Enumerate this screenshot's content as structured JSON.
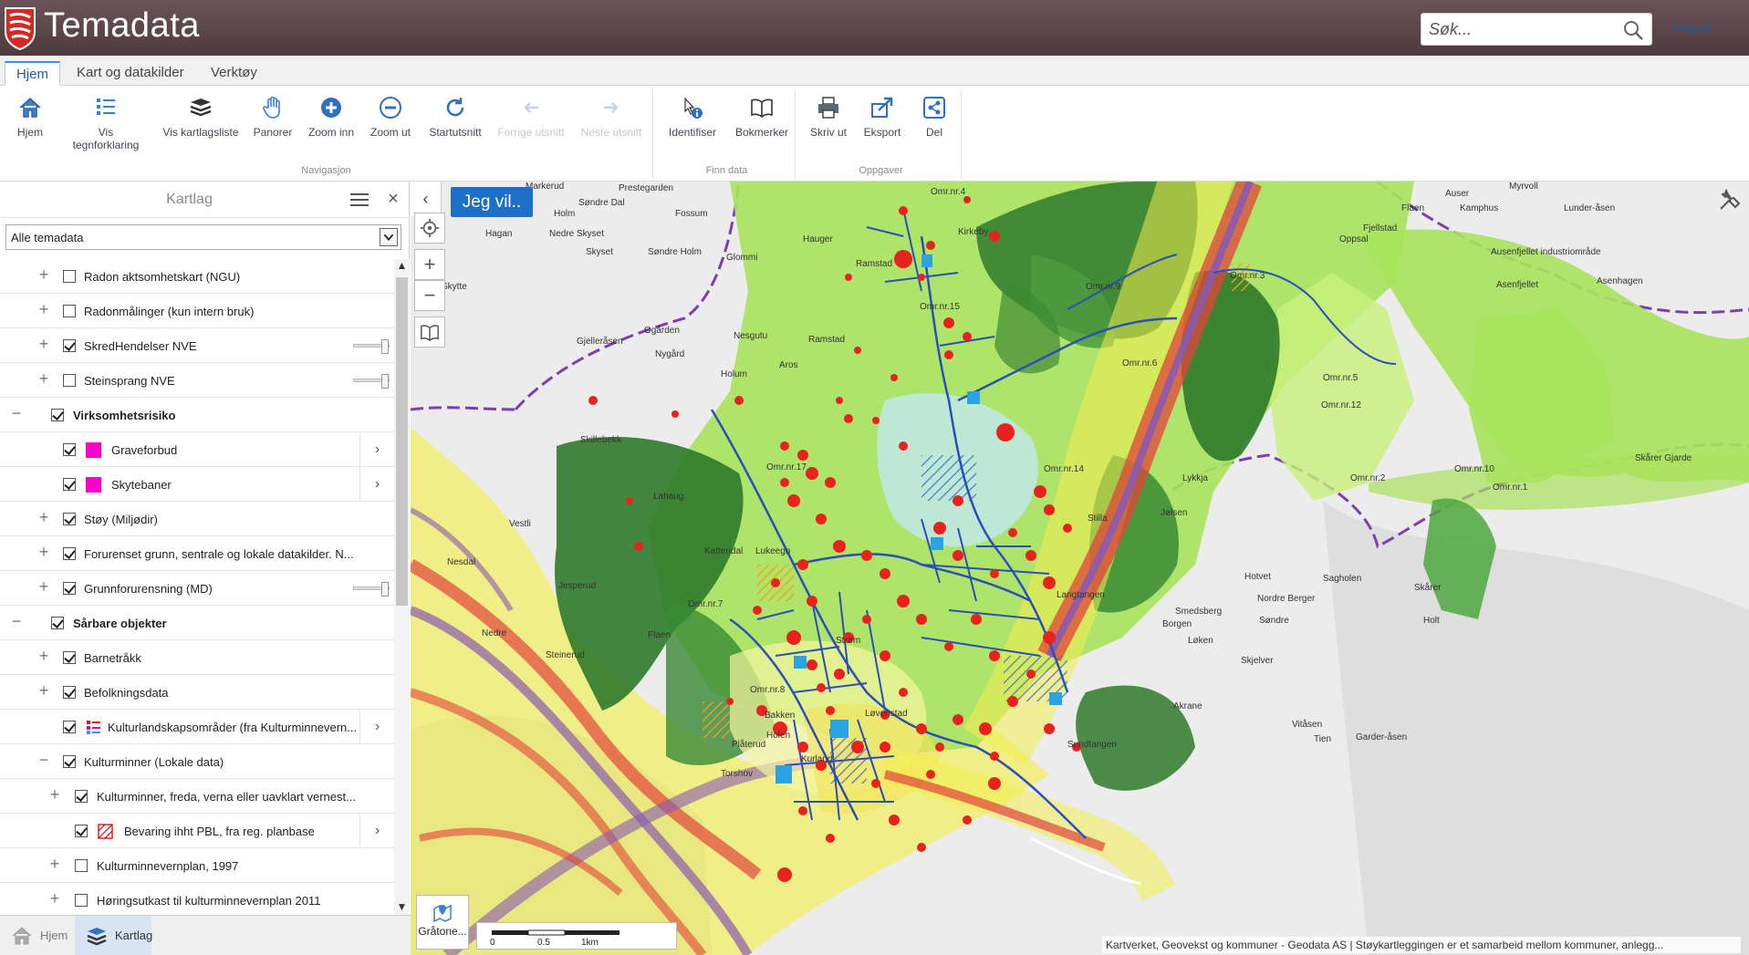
{
  "header": {
    "app_title": "Temadata",
    "search_placeholder": "Søk...",
    "logout": "Logg ut"
  },
  "tabs": [
    {
      "label": "Hjem",
      "active": true
    },
    {
      "label": "Kart og datakilder",
      "active": false
    },
    {
      "label": "Verktøy",
      "active": false
    }
  ],
  "ribbon": {
    "groups": {
      "navigasjon": "Navigasjon",
      "finn_data": "Finn data",
      "oppgaver": "Oppgaver"
    },
    "buttons": {
      "hjem": "Hjem",
      "vis_tegnforklaring": "Vis tegnforklaring",
      "vis_kartlagsliste": "Vis kartlagsliste",
      "panorer": "Panorer",
      "zoom_inn": "Zoom inn",
      "zoom_ut": "Zoom ut",
      "startutsnitt": "Startutsnitt",
      "forrige_utsnitt": "Forrige utsnitt",
      "neste_utsnitt": "Neste utsnitt",
      "identifiser": "Identifiser",
      "bokmerker": "Bokmerker",
      "skriv_ut": "Skriv ut",
      "eksport": "Eksport",
      "del": "Del"
    }
  },
  "panel": {
    "title": "Kartlag",
    "theme_select": "Alle temadata",
    "layers": [
      {
        "label": "Radon aktsomhetskart (NGU)",
        "checked": false,
        "expander": "+"
      },
      {
        "label": "Radonmålinger (kun intern bruk)",
        "checked": false,
        "expander": "+"
      },
      {
        "label": "SkredHendelser NVE",
        "checked": true,
        "expander": "+",
        "slider": true
      },
      {
        "label": "Steinsprang NVE",
        "checked": false,
        "expander": "+",
        "slider": true
      },
      {
        "label": "Virksomhetsrisiko",
        "checked": true,
        "expander": "−",
        "bold": true
      },
      {
        "label": "Graveforbud",
        "checked": true,
        "swatch": "#ff00cc",
        "chevron": true
      },
      {
        "label": "Skytebaner",
        "checked": true,
        "swatch": "#ff00cc",
        "chevron": true
      },
      {
        "label": "Støy (Miljødir)",
        "checked": true,
        "expander": "+"
      },
      {
        "label": "Forurenset grunn, sentrale og lokale datakilder. N...",
        "checked": true,
        "expander": "+"
      },
      {
        "label": "Grunnforurensning (MD)",
        "checked": true,
        "expander": "+",
        "slider": true
      },
      {
        "label": "Sårbare objekter",
        "checked": true,
        "expander": "−",
        "bold": true
      },
      {
        "label": "Barnetråkk",
        "checked": true,
        "expander": "+"
      },
      {
        "label": "Befolkningsdata",
        "checked": true,
        "expander": "+"
      },
      {
        "label": "Kulturlandskapsområder (fra Kulturminnevern...",
        "checked": true,
        "chevron": true
      },
      {
        "label": "Kulturminner (Lokale data)",
        "checked": true,
        "expander": "−"
      },
      {
        "label": "Kulturminner, freda, verna eller uavklart vernest...",
        "checked": true,
        "expander": "+"
      },
      {
        "label": "Bevaring ihht PBL, fra reg. planbase",
        "checked": true,
        "chevron": true
      },
      {
        "label": "Kulturminnevernplan, 1997",
        "checked": false,
        "expander": "+"
      },
      {
        "label": "Høringsutkast til kulturminnevernplan 2011",
        "checked": false,
        "expander": "+"
      }
    ]
  },
  "bottom_bar": {
    "hjem": "Hjem",
    "kartlag": "Kartlag"
  },
  "map": {
    "jeg_vil": "Jeg vil..",
    "base_map_label": "Gråtone...",
    "scale": {
      "s0": "0",
      "s1": "0.5",
      "s2": "1km"
    },
    "attribution": "Kartverket, Geovekst og kommuner - Geodata AS | Støykartleggingen er et samarbeid mellom kommuner, anlegg...",
    "labels": [
      "Markerud",
      "Prestegarden",
      "Søndre Dal",
      "Holm",
      "Hagan",
      "Nedre Skyset",
      "Skyset",
      "Søndre Holm",
      "Glommi",
      "Hauger",
      "Ramstad",
      "Ramstad",
      "Gjelleråsen",
      "Ogården",
      "Nygård",
      "Nesgutu",
      "Aros",
      "Holum",
      "Skillebekk",
      "Skytte",
      "Vestli",
      "Lahaug",
      "Kattendal",
      "Lukeegn",
      "Nedre",
      "Jesperud",
      "Omr.nr.4",
      "Omr.nr.15",
      "Omr.nr.14",
      "Omr.nr.17",
      "Omr.nr.7",
      "Omr.nr.8",
      "Omr.nr.3",
      "Omr.nr.6",
      "Omr.nr.5",
      "Omr.nr.2",
      "Omr.nr.1",
      "Omr.nr.12",
      "Omr.nr.9",
      "Omr.nr.10",
      "Myrvoll",
      "Auser",
      "Flaen",
      "Kamphus",
      "Fjellstad",
      "Oppsal",
      "Lunder-åsen",
      "Asenhagen",
      "Asenfjellet",
      "Ausenfjellet industriområde",
      "Strøm",
      "Løvenstad",
      "Holen",
      "Kurland",
      "Torshov",
      "Plåterud",
      "Jølsen",
      "Sagholen",
      "Hotvet",
      "Smedsberg",
      "Borgen",
      "Løken",
      "Akrane",
      "Vitåsen",
      "Tien",
      "Garder-åsen",
      "Holt",
      "Skårer",
      "Nordre Berger",
      "Søndre",
      "Skjelver",
      "Sundtangen",
      "Langtangen",
      "Steinerud",
      "Fossum",
      "Bakken",
      "Lykkja",
      "Stilla",
      "Nesdal",
      "Kirkeby",
      "Flaen",
      "Skårer Gjarde",
      "Brånerud"
    ]
  },
  "colors": {
    "header_bg": "#4e3b3f",
    "accent": "#1e6fc7",
    "zone_dark_green": "#2f7a2c",
    "zone_light_green": "#b6e86a",
    "noise_yellow": "#f3f040",
    "noise_red": "#e2443a",
    "noise_purple": "#8a5ab0",
    "road_blue": "#2b4fb8",
    "point_red": "#e8231e"
  },
  "icons": {
    "logo": "temadata-logo",
    "search": "search-icon"
  }
}
